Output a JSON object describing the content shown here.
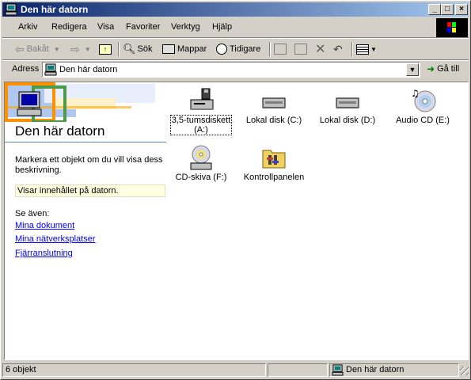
{
  "window": {
    "title": "Den här datorn"
  },
  "menu": [
    "Arkiv",
    "Redigera",
    "Visa",
    "Favoriter",
    "Verktyg",
    "Hjälp"
  ],
  "toolbar": {
    "back": "Bakåt",
    "search": "Sök",
    "folders": "Mappar",
    "history": "Tidigare"
  },
  "address": {
    "label": "Adress",
    "value": "Den här datorn",
    "go": "Gå till"
  },
  "leftpane": {
    "title": "Den här datorn",
    "description": "Markera ett objekt om du vill visa dess beskrivning.",
    "info": "Visar innehållet på datorn.",
    "see_also": "Se även:",
    "links": [
      "Mina dokument",
      "Mina nätverksplatser",
      "Fjärranslutning"
    ]
  },
  "items": [
    {
      "label_line1": "3,5-tumsdiskett",
      "label_line2": "(A:)",
      "icon": "floppy-drive-icon"
    },
    {
      "label": "Lokal disk (C:)",
      "icon": "hard-disk-icon"
    },
    {
      "label": "Lokal disk (D:)",
      "icon": "hard-disk-icon"
    },
    {
      "label": "Audio CD (E:)",
      "icon": "audio-cd-icon"
    },
    {
      "label": "CD-skiva (F:)",
      "icon": "cd-drive-icon"
    },
    {
      "label": "Kontrollpanelen",
      "icon": "control-panel-icon"
    }
  ],
  "status": {
    "count": "6 objekt",
    "location": "Den här datorn"
  }
}
